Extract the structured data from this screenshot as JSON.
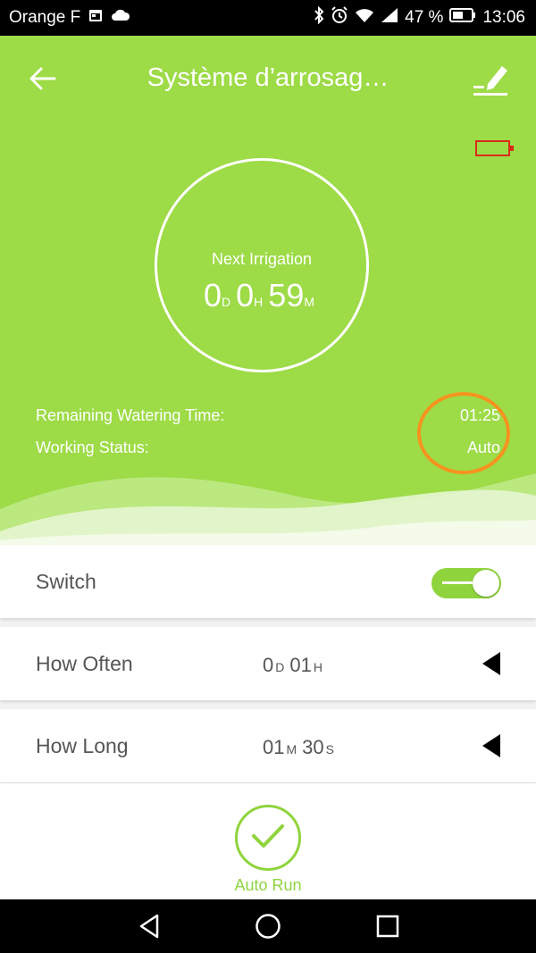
{
  "status_bar": {
    "carrier": "Orange F",
    "battery": "47 %",
    "time": "13:06",
    "icons": [
      "calendar-icon",
      "cloud-icon",
      "bluetooth-icon",
      "alarm-icon",
      "wifi-icon",
      "signal-icon",
      "battery-icon"
    ]
  },
  "header": {
    "title": "Système d’arrosag…",
    "back_icon": "arrow-left-icon",
    "edit_icon": "edit-pencil-icon",
    "device_battery_icon": "low-battery-icon",
    "device_battery_color": "#d92b1c"
  },
  "next_irrigation": {
    "label": "Next Irrigation",
    "days": "0",
    "days_unit": "D",
    "hours": "0",
    "hours_unit": "H",
    "minutes": "59",
    "minutes_unit": "M"
  },
  "info": {
    "remaining_label": "Remaining Watering Time:",
    "remaining_value": "01:25",
    "status_label": "Working Status:",
    "status_value": "Auto",
    "highlight_color": "#f7931e"
  },
  "settings": {
    "switch": {
      "label": "Switch",
      "on": true
    },
    "how_often": {
      "label": "How Often",
      "days": "0",
      "days_unit": "D",
      "hours": "01",
      "hours_unit": "H"
    },
    "how_long": {
      "label": "How Long",
      "minutes": "01",
      "minutes_unit": "M",
      "seconds": "30",
      "seconds_unit": "S"
    }
  },
  "auto_run": {
    "label": "Auto Run",
    "icon": "check-icon"
  },
  "colors": {
    "brand_green": "#9ddb47",
    "accent_green": "#8fd43d"
  },
  "nav": {
    "icons": [
      "back-triangle-icon",
      "home-circle-icon",
      "recents-square-icon"
    ]
  }
}
